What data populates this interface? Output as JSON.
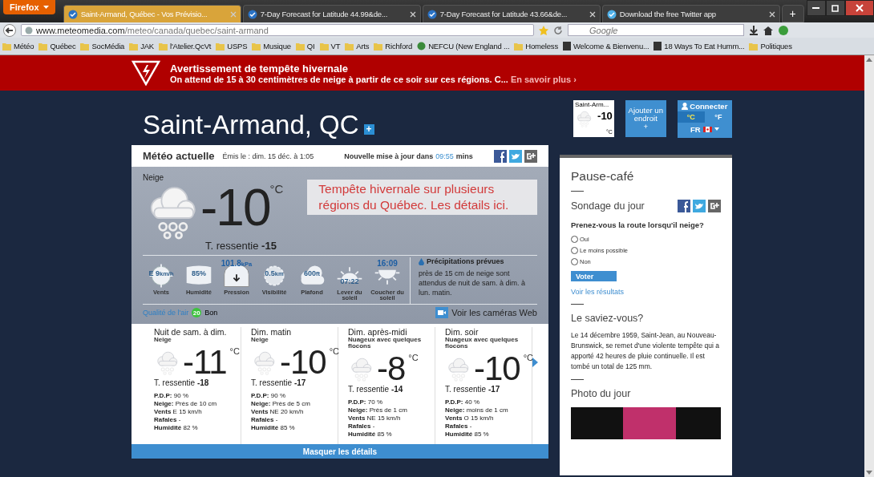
{
  "browser": {
    "menu_button": "Firefox",
    "tabs": [
      {
        "title": "Saint-Armand, Québec - Vos Prévisio...",
        "selected": true
      },
      {
        "title": "7-Day Forecast for Latitude 44.99&de...",
        "selected": false
      },
      {
        "title": "7-Day Forecast for Latitude 43.66&de...",
        "selected": false
      },
      {
        "title": "Download the free Twitter app",
        "selected": false
      }
    ],
    "new_tab": "+",
    "url_host": "www.meteomedia.com",
    "url_path": "/meteo/canada/quebec/saint-armand",
    "search_placeholder": "Google",
    "bookmarks": [
      {
        "label": "Météo",
        "kind": "folder"
      },
      {
        "label": "Québec",
        "kind": "folder"
      },
      {
        "label": "SocMédia",
        "kind": "folder"
      },
      {
        "label": "JAK",
        "kind": "folder"
      },
      {
        "label": "l'Atelier.QcVt",
        "kind": "folder"
      },
      {
        "label": "USPS",
        "kind": "folder"
      },
      {
        "label": "Musique",
        "kind": "folder"
      },
      {
        "label": "QI",
        "kind": "folder"
      },
      {
        "label": "VT",
        "kind": "folder"
      },
      {
        "label": "Arts",
        "kind": "folder"
      },
      {
        "label": "Richford",
        "kind": "folder"
      },
      {
        "label": "NEFCU (New England ...",
        "kind": "site"
      },
      {
        "label": "Homeless",
        "kind": "folder"
      },
      {
        "label": "Welcome & Bienvenu...",
        "kind": "page"
      },
      {
        "label": "18 Ways To Eat Humm...",
        "kind": "page"
      },
      {
        "label": "Politiques",
        "kind": "folder"
      }
    ]
  },
  "alert": {
    "title": "Avertissement de tempête hivernale",
    "text": "On attend de 15 à 30 centimètres de neige à partir de ce soir sur ces régions. C...",
    "link": "En savoir plus ›"
  },
  "location": {
    "name": "Saint-Armand, QC",
    "add": "+"
  },
  "widgets": {
    "mini_name": "Saint-Arm...",
    "mini_temp": "-10",
    "mini_unit": "°C",
    "add_label": "Ajouter un endroit",
    "add_plus": "+",
    "connect": "Connecter",
    "units": [
      {
        "label": "°C",
        "selected": true
      },
      {
        "label": "°F",
        "selected": false
      }
    ],
    "language": "FR"
  },
  "current": {
    "title": "Météo actuelle",
    "issued": "Émis le : dim. 15 déc. à 1:05",
    "update_prefix": "Nouvelle mise à jour dans",
    "update_time": "09:55",
    "update_suffix": "mins",
    "condition": "Neige",
    "temp": "-10",
    "unit": "°C",
    "feels": "T. ressentie **-15**",
    "promo": "Tempête hivernale sur plusieurs régions du Québec. Les détails ici.",
    "stats": [
      {
        "kind": "wind",
        "value": "E 9",
        "unit": "km/h",
        "label": "Vents"
      },
      {
        "kind": "humidity",
        "value": "85%",
        "label": "Humidité"
      },
      {
        "kind": "pressure",
        "value": "101.8",
        "unit": "kPa",
        "label": "Pression"
      },
      {
        "kind": "visibility",
        "value": "0.5",
        "unit": "km",
        "label": "Visibilité"
      },
      {
        "kind": "ceiling",
        "value": "600",
        "unit": "ft",
        "label": "Plafond"
      },
      {
        "kind": "sunrise",
        "value": "07:22",
        "label": "Lever du soleil"
      },
      {
        "kind": "sunset",
        "value": "16:09",
        "label": "Coucher du soleil"
      }
    ],
    "precip_title": "Précipitations prévues",
    "precip_text": "près de 15 cm de neige sont attendus de nuit de sam. à dim. à lun. matin.",
    "air_label": "Qualité de l'air",
    "air_index": "20",
    "air_value": "Bon",
    "webcams": "Voir les caméras Web"
  },
  "forecast": {
    "periods": [
      {
        "title": "Nuit de sam. à dim.",
        "condition": "Neige",
        "temp": "-11",
        "unit": "°C",
        "feels": "T. ressentie **-18**",
        "details": [
          "**P.D.P:** 90 %",
          "**Neige:** Près de 10 cm",
          "**Vents** E 15 km/h",
          "**Rafales** -",
          "**Humidité** 82 %"
        ]
      },
      {
        "title": "Dim. matin",
        "condition": "Neige",
        "temp": "-10",
        "unit": "°C",
        "feels": "T. ressentie **-17**",
        "details": [
          "**P.D.P:** 90 %",
          "**Neige:** Près de 5 cm",
          "**Vents** NE 20 km/h",
          "**Rafales** -",
          "**Humidité** 85 %"
        ]
      },
      {
        "title": "Dim. après-midi",
        "condition": "Nuageux avec quelques flocons",
        "temp": "-8",
        "unit": "°C",
        "feels": "T. ressentie **-14**",
        "details": [
          "**P.D.P:** 70 %",
          "**Neige:** Près de 1 cm",
          "**Vents** NE 15 km/h",
          "**Rafales** -",
          "**Humidité** 85 %"
        ]
      },
      {
        "title": "Dim. soir",
        "condition": "Nuageux avec quelques flocons",
        "temp": "-10",
        "unit": "°C",
        "feels": "T. ressentie **-17**",
        "details": [
          "**P.D.P:** 40 %",
          "**Neige:** moins de 1 cm",
          "**Vents** O 15 km/h",
          "**Rafales** -",
          "**Humidité** 85 %"
        ]
      }
    ],
    "hide": "Masquer les détails"
  },
  "sidebar": {
    "title": "Pause-café",
    "poll_title": "Sondage du jour",
    "question": "Prenez-vous la route lorsqu'il neige?",
    "options": [
      {
        "label": "Oui",
        "selected": false
      },
      {
        "label": "Le moins possible",
        "selected": false
      },
      {
        "label": "Non",
        "selected": false
      }
    ],
    "vote": "Voter",
    "results": "Voir les résultats",
    "fact_title": "Le saviez-vous?",
    "fact": "Le 14 décembre 1959, Saint-Jean, au Nouveau-Brunswick, se remet d'une violente tempête qui a apporté 42 heures de pluie continuelle. Il est tombé un total de 125 mm.",
    "photo_title": "Photo du jour"
  }
}
